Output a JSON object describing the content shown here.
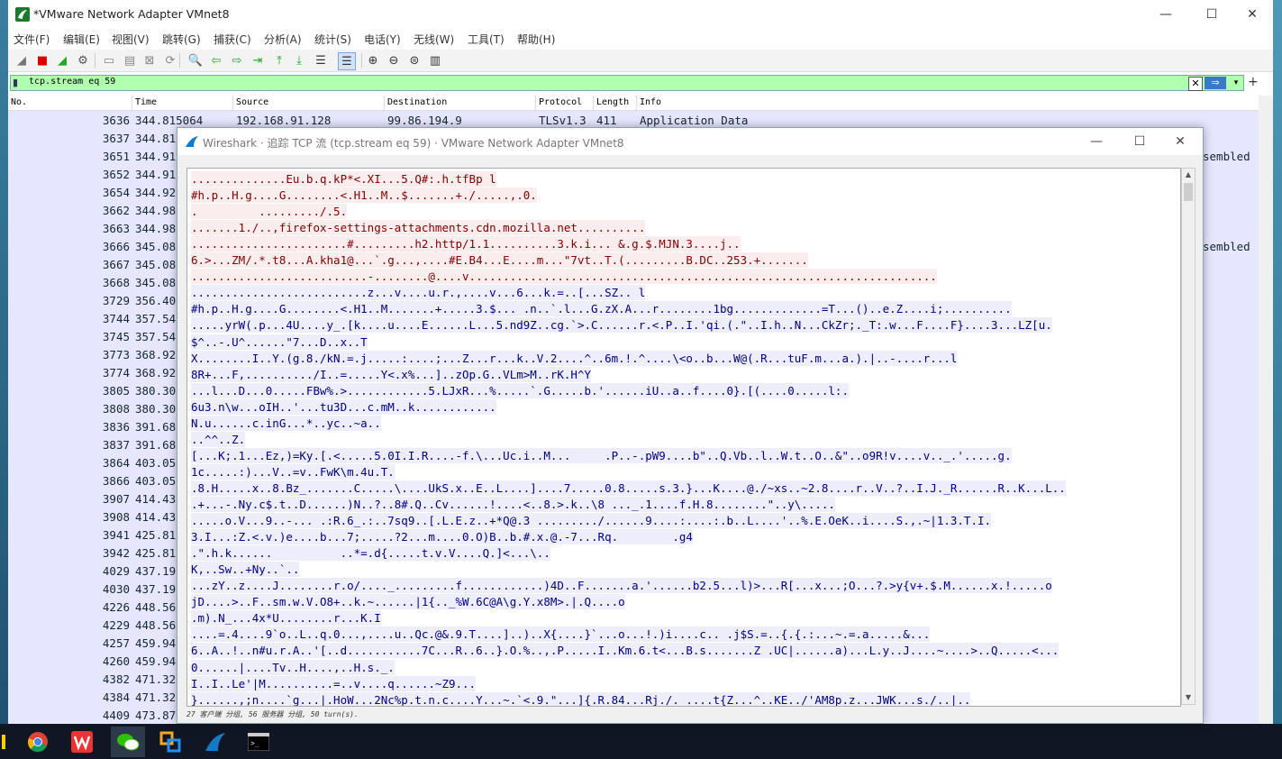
{
  "main_window": {
    "title": "*VMware Network Adapter VMnet8",
    "controls": {
      "minimize": "—",
      "maximize": "☐",
      "close": "✕"
    }
  },
  "menu": [
    "文件(F)",
    "编辑(E)",
    "视图(V)",
    "跳转(G)",
    "捕获(C)",
    "分析(A)",
    "统计(S)",
    "电话(Y)",
    "无线(W)",
    "工具(T)",
    "帮助(H)"
  ],
  "toolbar_icons": [
    "shark-fin-icon",
    "stop-icon",
    "restart-icon",
    "options-gear-icon",
    "open-file-icon",
    "save-file-icon",
    "close-file-icon",
    "reload-icon",
    "find-icon",
    "back-arrow-icon",
    "forward-arrow-icon",
    "goto-packet-icon",
    "first-packet-icon",
    "last-packet-icon",
    "autoscroll-icon",
    "colorize-icon",
    "zoom-in-icon",
    "zoom-out-icon",
    "normal-size-icon",
    "resize-columns-icon"
  ],
  "filter": {
    "value": "tcp.stream eq 59",
    "apply_symbol": "⇒",
    "clear_symbol": "✕",
    "dropdown_symbol": "▾",
    "add_symbol": "+"
  },
  "columns": [
    "No.",
    "Time",
    "Source",
    "Destination",
    "Protocol",
    "Length",
    "Info"
  ],
  "packets": [
    {
      "no": "3636",
      "time": "344.815064",
      "source": "192.168.91.128",
      "destination": "99.86.194.9",
      "protocol": "TLSv1.3",
      "length": "411",
      "info": "Application Data"
    },
    {
      "no": "3637",
      "time": "344.81",
      "info": ""
    },
    {
      "no": "3651",
      "time": "344.91",
      "info": "sembled"
    },
    {
      "no": "3652",
      "time": "344.91",
      "info": ""
    },
    {
      "no": "3654",
      "time": "344.92",
      "info": ""
    },
    {
      "no": "3662",
      "time": "344.98",
      "info": ""
    },
    {
      "no": "3663",
      "time": "344.98",
      "info": ""
    },
    {
      "no": "3666",
      "time": "345.08",
      "info": "sembled"
    },
    {
      "no": "3667",
      "time": "345.08",
      "info": ""
    },
    {
      "no": "3668",
      "time": "345.08",
      "info": ""
    },
    {
      "no": "3729",
      "time": "356.40",
      "info": ""
    },
    {
      "no": "3744",
      "time": "357.54",
      "info": ""
    },
    {
      "no": "3745",
      "time": "357.54",
      "info": ""
    },
    {
      "no": "3773",
      "time": "368.92",
      "info": ""
    },
    {
      "no": "3774",
      "time": "368.92",
      "info": ""
    },
    {
      "no": "3805",
      "time": "380.30",
      "info": ""
    },
    {
      "no": "3808",
      "time": "380.30",
      "info": ""
    },
    {
      "no": "3836",
      "time": "391.68",
      "info": ""
    },
    {
      "no": "3837",
      "time": "391.68",
      "info": ""
    },
    {
      "no": "3864",
      "time": "403.05",
      "info": ""
    },
    {
      "no": "3866",
      "time": "403.05",
      "info": ""
    },
    {
      "no": "3907",
      "time": "414.43",
      "info": ""
    },
    {
      "no": "3908",
      "time": "414.43",
      "info": ""
    },
    {
      "no": "3941",
      "time": "425.81",
      "info": ""
    },
    {
      "no": "3942",
      "time": "425.81",
      "info": ""
    },
    {
      "no": "4029",
      "time": "437.19",
      "info": ""
    },
    {
      "no": "4030",
      "time": "437.19",
      "info": ""
    },
    {
      "no": "4226",
      "time": "448.56",
      "info": ""
    },
    {
      "no": "4229",
      "time": "448.56",
      "info": ""
    },
    {
      "no": "4257",
      "time": "459.94",
      "info": ""
    },
    {
      "no": "4260",
      "time": "459.94",
      "info": ""
    },
    {
      "no": "4382",
      "time": "471.32",
      "info": ""
    },
    {
      "no": "4384",
      "time": "471.32",
      "info": ""
    },
    {
      "no": "4409",
      "time": "473.87",
      "info": ""
    }
  ],
  "dialog": {
    "title": "Wireshark · 追踪 TCP 流 (tcp.stream eq 59) · VMware Network Adapter VMnet8",
    "controls": {
      "minimize": "—",
      "maximize": "☐",
      "close": "✕"
    },
    "status": "27 客户端 分组, 56 服务器 分组, 50 turn(s).",
    "lines": [
      {
        "dir": "c",
        "text": "..............Eu.b.q.kP*<.XI...5.Q#:.h.tfBp l"
      },
      {
        "dir": "c",
        "text": "#h.p..H.g....G........<.H1..M..$.......+./.....,.0."
      },
      {
        "dir": "c",
        "text": ".         ........./.5."
      },
      {
        "dir": "c",
        "text": ".......1./..,firefox-settings-attachments.cdn.mozilla.net.........."
      },
      {
        "dir": "c",
        "text": ".......................#.........h2.http/1.1..........3.k.i... &.g.$.MJN.3....j.."
      },
      {
        "dir": "c",
        "text": "6.>...ZM/.*.t8...A.kha1@...`.g...,....#E.B4...E....m...\"7vt..T.(.........B.DC..253.+......."
      },
      {
        "dir": "c",
        "text": "..........................-........@....v....................................................................."
      },
      {
        "dir": "s",
        "text": "..........................z...v....u.r.,....v...6...k.=..[...SZ.. l"
      },
      {
        "dir": "s",
        "text": "#h.p..H.g....G........<.H1..M.......+.....3.$... .n..`.l...G.zX.A...r........1bg.............=T...()..e.Z....i;.........."
      },
      {
        "dir": "s",
        "text": ".....yrW(.p...4U....y_.[k....u....E......L...5.nd9Z..cg.`>.C......r.<.P..I.'qi.(.\"..I.h..N...CkZr;._T:.w...F....F}....3...LZ[u."
      },
      {
        "dir": "s",
        "text": "$^..-.U^......\"7...D..x..T"
      },
      {
        "dir": "s",
        "text": "X........I..Y.(g.8./kN.=.j.....:....;...Z...r...k..V.2....^..6m.!.^....\\<o..b...W@(.R...tuF.m...a.).|..-....r...l"
      },
      {
        "dir": "s",
        "text": "8R+...F,........../I..=.....Y<.x%...]..zOp.G..VLm>M..rK.H^Y"
      },
      {
        "dir": "s",
        "text": "...l...D...0.....FBw%.>............5.LJxR...%.....`.G.....b.'......iU..a..f....0}.[(....0.....l:."
      },
      {
        "dir": "s",
        "text": "6u3.n\\w...oIH..'...tu3D...c.mM..k............"
      },
      {
        "dir": "s",
        "text": "N.u......c.inG...*..yc..~a.."
      },
      {
        "dir": "s",
        "text": "..^^..Z."
      },
      {
        "dir": "s",
        "text": "[...K;.1...Ez,)=Ky.[.<.....5.0I.I.R....-f.\\...Uc.i..M...     .P..-.pW9....b\"..Q.Vb..l..W.t..O..&\"..o9R!v....v.._.'.....g."
      },
      {
        "dir": "s",
        "text": "1c.....:)...V..=v..FwK\\m.4u.T."
      },
      {
        "dir": "s",
        "text": ".8.H.....x..8.Bz_.......C.....\\....UkS.x..E..L....]....7.....0.8.....s.3.}...K....@./~xs..~2.8....r..V..?..I.J._R......R..K...L.."
      },
      {
        "dir": "s",
        "text": ".+...-.Ny.c$.t..D......)N..?..8#.Q..Cv......!....<..8.>.k..\\8 ..._.1....f.H.8........\"..y\\....."
      },
      {
        "dir": "s",
        "text": ".....o.V...9..-... .:R.6_.:..7sq9..[.L.E.z..+*Q@.3 ........./......9....:....:.b..L....'..%.E.OeK..i....S.,.~|1.3.T.I."
      },
      {
        "dir": "s",
        "text": "3.I...:Z.<.v.)e....b...7;.....?2...m....0.O)B..b.#.x.@.-7...Rq.        .g4"
      },
      {
        "dir": "s",
        "text": ".\".h.k......          ..*=.d{.....t.v.V....Q.]<...\\.."
      },
      {
        "dir": "s",
        "text": "K,..Sw..+Ny..`.."
      },
      {
        "dir": "s",
        "text": "...zY..z....J........r.o/...._.........f............)4D..F.......a.'......b2.5...l)>...R[...x...;O...?.>y{v+.$.M......x.!.....o"
      },
      {
        "dir": "s",
        "text": "jD....>..F..sm.w.V.O8+..k.~......|1{.._%W.6C@A\\g.Y.x8M>.|.Q....o"
      },
      {
        "dir": "s",
        "text": ".m).N_...4x*U........r...K.I"
      },
      {
        "dir": "s",
        "text": "....=.4....9`o..L..q.0...,....u..Qc.@&.9.T....]..)..X{....}`...o...!.)i....c.. .j$S.=..{.{.:...~.=.a.....&..."
      },
      {
        "dir": "s",
        "text": "6..A..!..n#u.r.A..'[..d...........7C...R..6..}.O.%..,.P.....I..Km.6.t<...B.s.......Z .UC|......a)...L.y..J....~....>..Q.....<..."
      },
      {
        "dir": "s",
        "text": "0......|....Tv..H....,..H.s._."
      },
      {
        "dir": "s",
        "text": "I..I..Le'|M..........=..v....q......~Z9..."
      },
      {
        "dir": "s",
        "text": "}......,;n....`g...|.HoW...2Nc%p.t.n.c....Y...~.`<.9.\"...]{.R.84...Rj./._....t{Z...^..KE../'AM8p.z...JWK...s./..|.."
      }
    ]
  },
  "taskbar": [
    "start-icon",
    "chrome-icon",
    "wps-icon",
    "wechat-icon",
    "app-icon",
    "wireshark-icon",
    "terminal-icon"
  ],
  "colors": {
    "client_text": "#7f0000",
    "client_bg": "#fbeded",
    "server_text": "#00007f",
    "server_bg": "#ededfb",
    "filter_ok": "#afffaf",
    "row_bg": "#e7e6ff"
  }
}
